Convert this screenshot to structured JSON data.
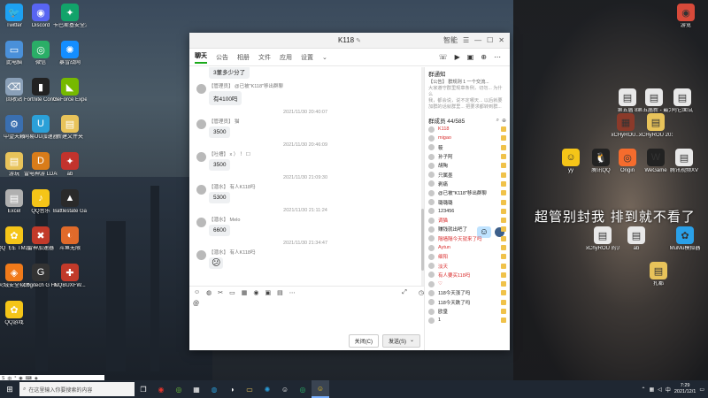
{
  "window": {
    "title": "K118",
    "header_tag": "智能",
    "tabs": [
      "聊天",
      "公告",
      "相册",
      "文件",
      "应用",
      "设置"
    ]
  },
  "messages": [
    {
      "type": "partial",
      "text": "3董多少分了"
    },
    {
      "who": "【管理员】 @已被\"K118\"移出群聊",
      "text": "有4100吗"
    },
    {
      "time": "2021/11/30 20:40:07"
    },
    {
      "who": "【管理员】 猫",
      "text": "3500"
    },
    {
      "time": "2021/11/30 20:46:09"
    },
    {
      "who": "【吐槽】 x ） ！ ☐",
      "text": "3500"
    },
    {
      "time": "2021/11/30 21:09:30"
    },
    {
      "who": "【潜水】 有人K118吗",
      "text": "5300"
    },
    {
      "time": "2021/11/30 21:11:24"
    },
    {
      "who": "【潜水】 Melo",
      "text": "6600"
    },
    {
      "time": "2021/11/30 21:34:47"
    },
    {
      "who": "【潜水】 有人K118吗",
      "text": "😕"
    }
  ],
  "input": {
    "value": "@"
  },
  "buttons": {
    "close": "关闭(C)",
    "send": "发送(S)"
  },
  "side": {
    "notice_title": "群通知",
    "notice_lines": [
      "【公告】 群规则 1 一个交流...",
      "大家遵守群里规章条例，切勿... 为什么",
      "我，都会说，说不定哪天... 以后就要",
      "加群的话就群里... 把要求都转到群..."
    ],
    "members_title": "群成员 44/585",
    "members": [
      {
        "name": "K118",
        "red": true
      },
      {
        "name": "migao",
        "red": true
      },
      {
        "name": "筱",
        "red": false
      },
      {
        "name": "孙子阿",
        "red": false
      },
      {
        "name": "胡陶",
        "red": false
      },
      {
        "name": "只属墨",
        "red": false
      },
      {
        "name": "剥痛",
        "red": false
      },
      {
        "name": "@已被\"K118\"移出群聊",
        "red": false
      },
      {
        "name": "璐璐璐",
        "red": false
      },
      {
        "name": "123456",
        "red": false
      },
      {
        "name": "调猫",
        "red": true
      },
      {
        "name": "赚钱就出吧了",
        "red": false
      },
      {
        "name": "隔墙隔今天就来了吗",
        "red": true
      },
      {
        "name": "Aytun",
        "red": true
      },
      {
        "name": "细阳",
        "red": true
      },
      {
        "name": "淡天",
        "red": true
      },
      {
        "name": "有人要买118吗",
        "red": true
      },
      {
        "name": "♡",
        "red": true
      },
      {
        "name": "118今天涨了吗",
        "red": false
      },
      {
        "name": "118今天跌了吗",
        "red": false
      },
      {
        "name": "欧皇",
        "red": false
      },
      {
        "name": "1",
        "red": false
      }
    ]
  },
  "desktop_icons": [
    {
      "label": "Twitter",
      "color": "#1da1f2",
      "glyph": "🐦"
    },
    {
      "label": "Discord",
      "color": "#5865f2",
      "glyph": "◉"
    },
    {
      "label": "卡巴斯基安全浏览",
      "color": "#12a36a",
      "glyph": "✦"
    },
    {
      "label": "此电脑",
      "color": "#4a90d9",
      "glyph": "▭"
    },
    {
      "label": "微信",
      "color": "#2aae67",
      "glyph": "◎"
    },
    {
      "label": "暴雪战网",
      "color": "#148eff",
      "glyph": "✺"
    },
    {
      "label": "回收站",
      "color": "#8aa0b8",
      "glyph": "⌫"
    },
    {
      "label": "Fortnite Control",
      "color": "#222",
      "glyph": "▮"
    },
    {
      "label": "GeForce Experience",
      "color": "#76b900",
      "glyph": "◣"
    },
    {
      "label": "中望天籁",
      "color": "#3a6fb0",
      "glyph": "⚙"
    },
    {
      "label": "网易UU加速器",
      "color": "#2ba0d8",
      "glyph": "U"
    },
    {
      "label": "新建文件夹",
      "color": "#e8c35a",
      "glyph": "▤"
    },
    {
      "label": "游玩",
      "color": "#e8c35a",
      "glyph": "▤"
    },
    {
      "label": "雷电神游 LDAPP游戏",
      "color": "#d97c1a",
      "glyph": "D"
    },
    {
      "label": "ab",
      "color": "#c2332d",
      "glyph": "✦"
    },
    {
      "label": "Excel",
      "color": "#b0b0b0",
      "glyph": "▤"
    },
    {
      "label": "QQ音乐",
      "color": "#f5c518",
      "glyph": "♪"
    },
    {
      "label": "Battlestate Games L...",
      "color": "#2a2a2a",
      "glyph": "▲"
    },
    {
      "label": "QQ飞车 TM游戏工具",
      "color": "#f5c518",
      "glyph": "✿"
    },
    {
      "label": "雷神加速器",
      "color": "#c23a2a",
      "glyph": "✖"
    },
    {
      "label": "斗鱼无限",
      "color": "#e06a2a",
      "glyph": "◐"
    },
    {
      "label": "火绒安全软件",
      "color": "#f07a1a",
      "glyph": "◈"
    },
    {
      "label": "Logitech G HUB",
      "color": "#333",
      "glyph": "G"
    },
    {
      "label": "NQBUXFW...",
      "color": "#c23a2a",
      "glyph": "✚"
    },
    {
      "label": "QQ游戏",
      "color": "#f5c518",
      "glyph": "✿"
    }
  ],
  "right_icons": [
    {
      "label": "游览",
      "color": "#d84a3a",
      "glyph": "◉"
    },
    {
      "label": "第五届 8",
      "color": "#e8e8e8",
      "glyph": "▤"
    },
    {
      "label": "第五届新 - 最大值",
      "color": "#e8e8e8",
      "glyph": "▤"
    },
    {
      "label": "阿它面试",
      "color": "#e8e8e8",
      "glyph": "▤"
    },
    {
      "label": "xCHyROU...",
      "color": "#8b3a2a",
      "glyph": "▦"
    },
    {
      "label": "xCHyROU 20130118",
      "color": "#e8c35a",
      "glyph": "▤"
    },
    {
      "label": "yy",
      "color": "#f5c518",
      "glyph": "☺"
    },
    {
      "label": "腾讯QQ",
      "color": "#222",
      "glyph": "🐧"
    },
    {
      "label": "Origin",
      "color": "#f56c2d",
      "glyph": "◎"
    },
    {
      "label": "WeGame",
      "color": "#222",
      "glyph": "W"
    },
    {
      "label": "腾讯视频XV",
      "color": "#e8e8e8",
      "glyph": "▤"
    },
    {
      "label": "xChyROU 的流",
      "color": "#e8e8e8",
      "glyph": "▤"
    },
    {
      "label": "ab",
      "color": "#e8e8e8",
      "glyph": "▤"
    },
    {
      "label": "MuMu模拟器",
      "color": "#2aa0e8",
      "glyph": "✿"
    },
    {
      "label": "扎都",
      "color": "#e8c35a",
      "glyph": "▤"
    }
  ],
  "overlay_text": "超管别封我 排到就不看了",
  "taskbar": {
    "search_placeholder": "在这里输入你要搜索的内容",
    "time": "7:29",
    "date": "2021/12/1"
  }
}
